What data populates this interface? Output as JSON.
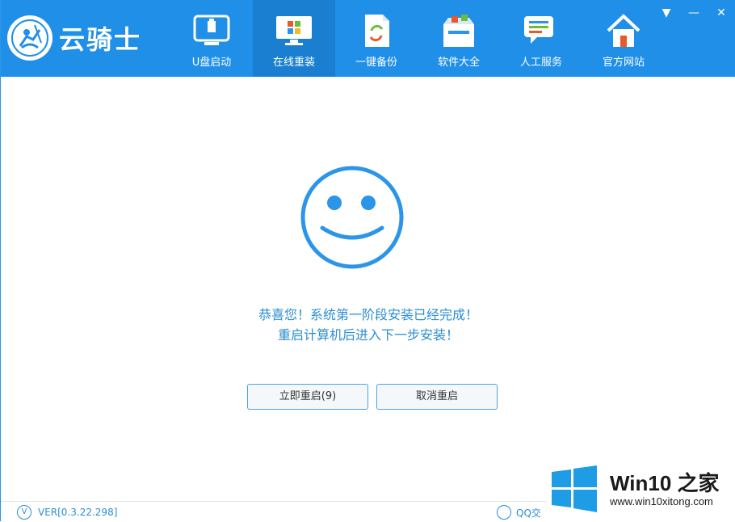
{
  "app": {
    "name": "云骑士"
  },
  "nav": [
    {
      "label": "U盘启动",
      "icon": "usb-drive-icon"
    },
    {
      "label": "在线重装",
      "icon": "windows-monitor-icon",
      "active": true
    },
    {
      "label": "一键备份",
      "icon": "backup-document-icon"
    },
    {
      "label": "软件大全",
      "icon": "software-box-icon"
    },
    {
      "label": "人工服务",
      "icon": "chat-service-icon"
    },
    {
      "label": "官方网站",
      "icon": "home-icon"
    }
  ],
  "window": {
    "menu_glyph": "▼",
    "minimize_glyph": "—",
    "close_glyph": "✕"
  },
  "main": {
    "line1": "恭喜您！系统第一阶段安装已经完成！",
    "line2": "重启计算机后进入下一步安装！",
    "restart_label": "立即重启(9)",
    "cancel_label": "取消重启"
  },
  "footer": {
    "ver_glyph": "V",
    "version": "VER[0.3.22.298]",
    "qq_label": "QQ交"
  },
  "watermark": {
    "title": "Win10 之家",
    "url": "www.win10xitong.com"
  },
  "colors": {
    "header_bg": "#1f8fe8",
    "active_tab": "#1a7fd0",
    "accent": "#2b8ed1",
    "win_blue": "#1e9de6"
  }
}
